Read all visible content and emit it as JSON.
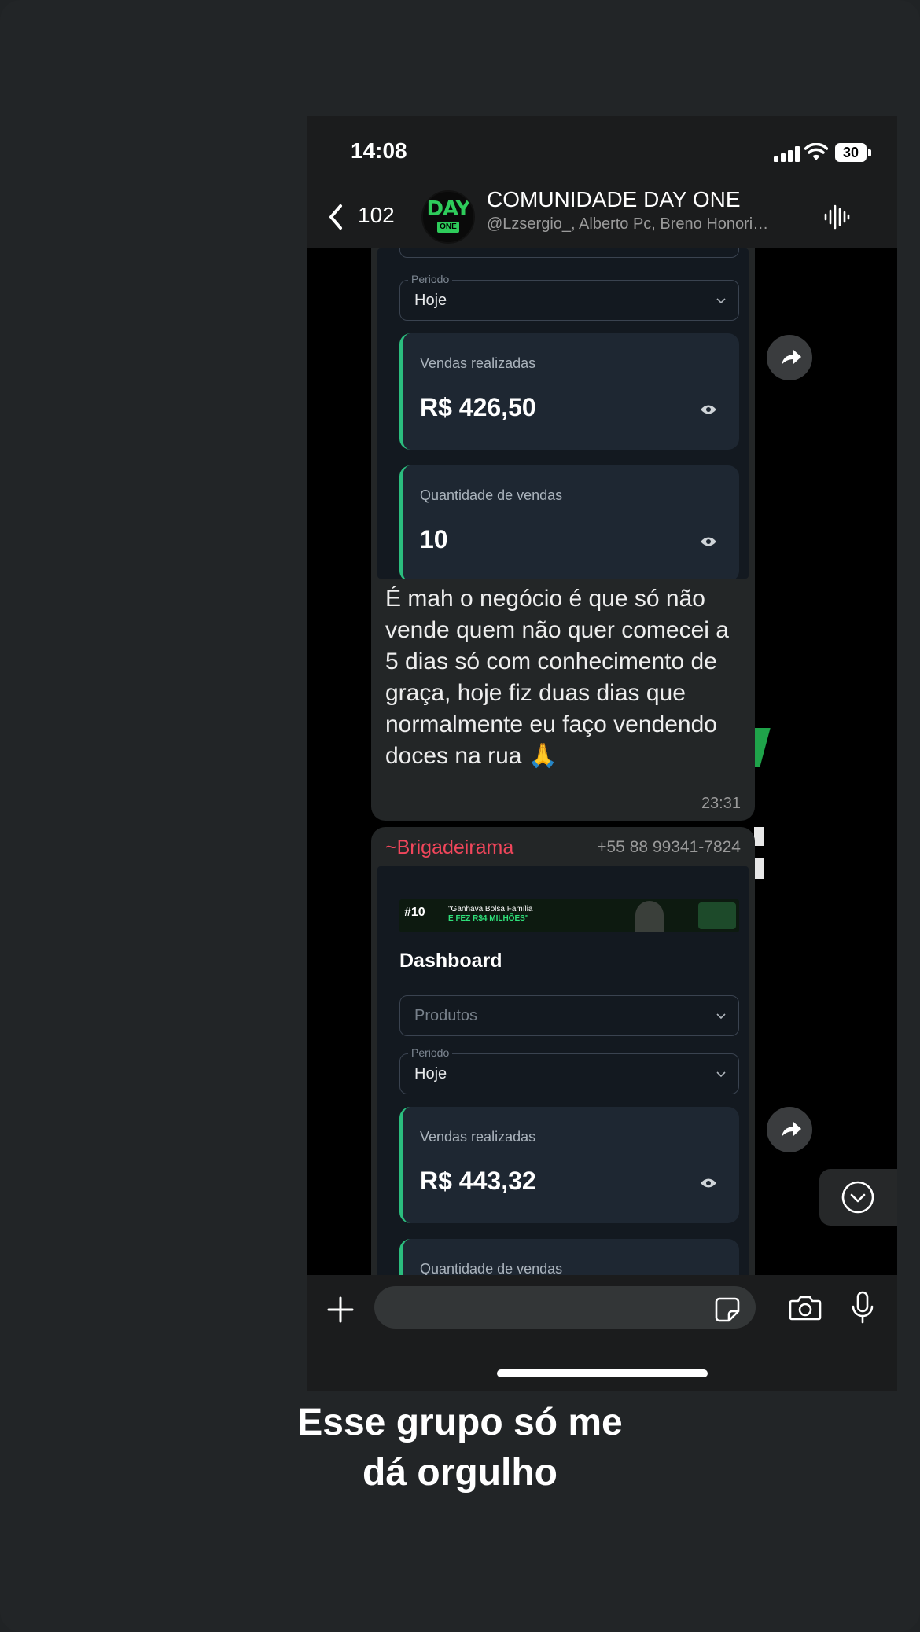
{
  "status_bar": {
    "time": "14:08",
    "battery": "30"
  },
  "header": {
    "back_count": "102",
    "avatar_text_top": "DAY",
    "avatar_text_bottom": "ONE",
    "title": "COMUNIDADE DAY ONE",
    "subtitle": "@Lzsergio_, Alberto Pc, Breno Honori…"
  },
  "message1": {
    "screenshot": {
      "period_legend": "Periodo",
      "period_value": "Hoje",
      "card1_label": "Vendas realizadas",
      "card1_value": "R$ 426,50",
      "card2_label": "Quantidade de vendas",
      "card2_value": "10"
    },
    "text": "É mah o negócio é que só não vende quem não quer comecei a 5 dias só com conhecimento de graça, hoje fiz duas dias que normalmente eu faço vendendo doces na rua 🙏",
    "time": "23:31"
  },
  "message2": {
    "sender": "~Brigadeirama",
    "phone": "+55 88 99341-7824",
    "screenshot": {
      "banner_line1": "\"Ganhava Bolsa Família",
      "banner_line2": "E FEZ R$4 MILHÕES\"",
      "dashboard_title": "Dashboard",
      "products_placeholder": "Produtos",
      "period_legend": "Periodo",
      "period_value": "Hoje",
      "card1_label": "Vendas realizadas",
      "card1_value": "R$ 443,32",
      "card2_label": "Quantidade de vendas"
    }
  },
  "caption": {
    "line1": "Esse grupo só me",
    "line2": "dá orgulho"
  },
  "colors": {
    "sender": "#f0465b",
    "accent_green": "#2bbd7e",
    "chat_bg": "#000000"
  }
}
